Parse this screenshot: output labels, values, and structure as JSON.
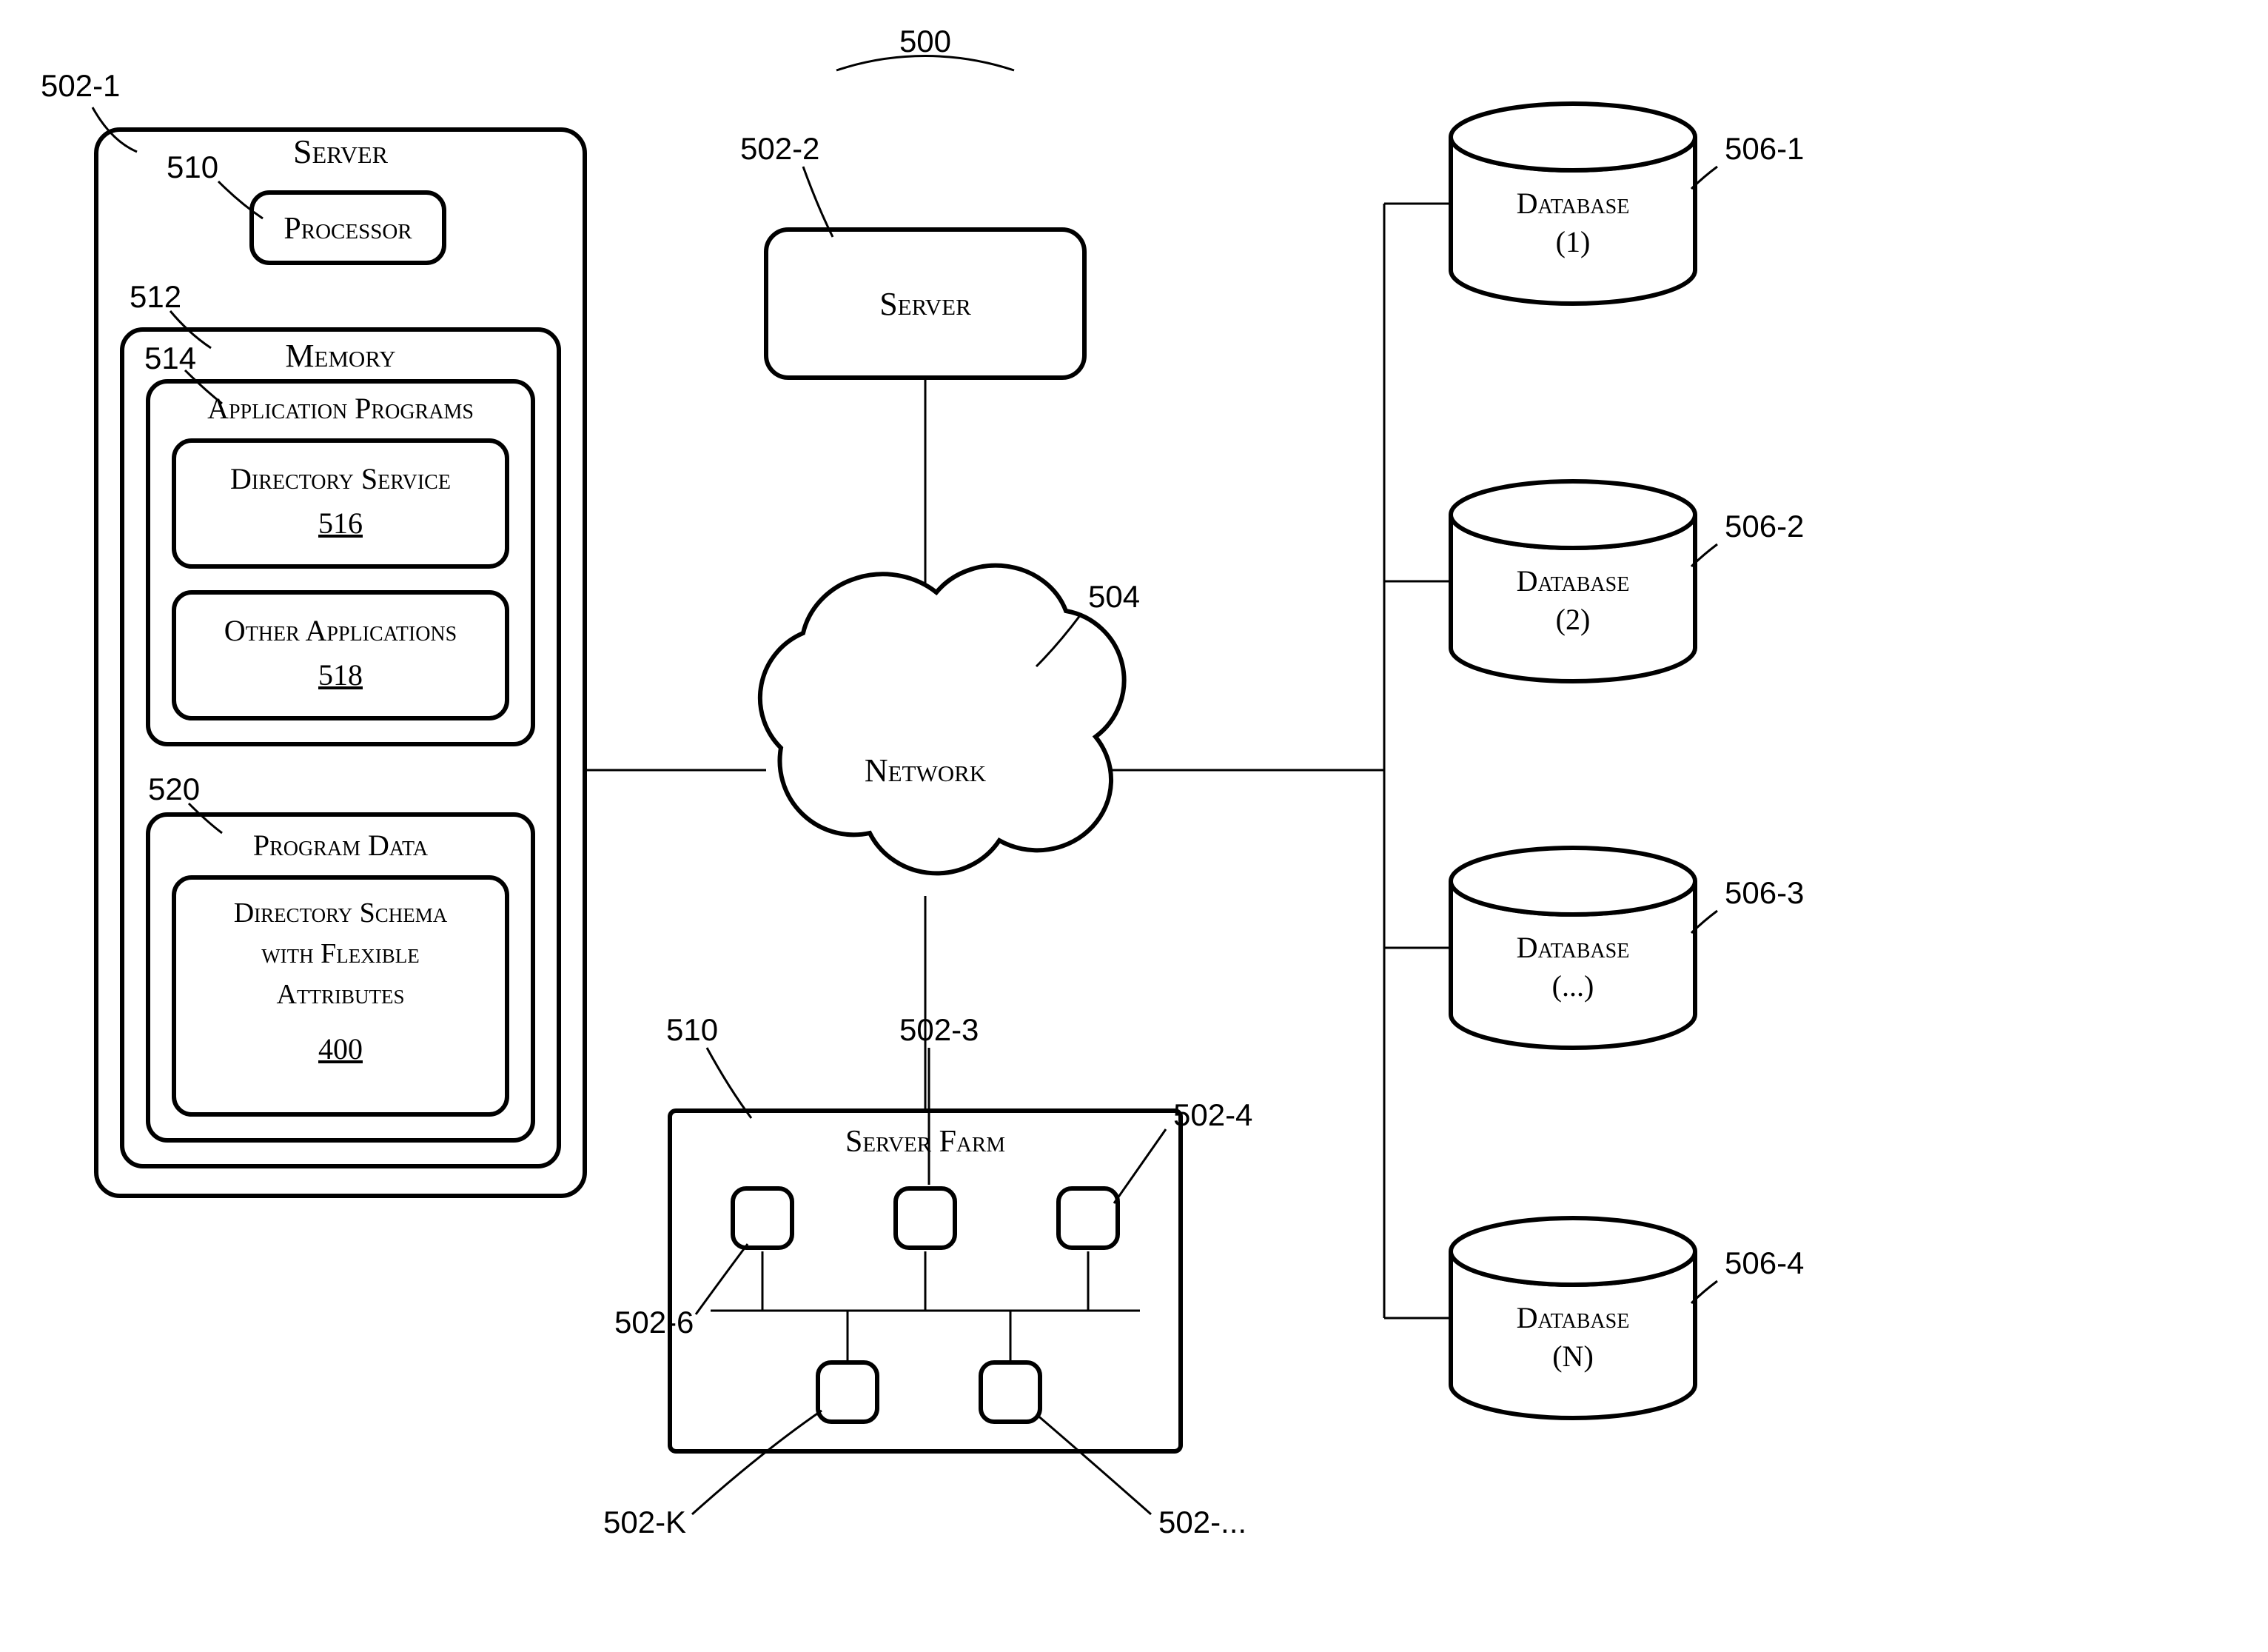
{
  "refs": {
    "figure": "500",
    "server1": "502-1",
    "server2": "502-2",
    "server_farm_3": "502-3",
    "server_farm_4": "502-4",
    "server_farm_6": "502-6",
    "server_farm_k": "502-K",
    "server_farm_dots": "502-...",
    "network": "504",
    "db1": "506-1",
    "db2": "506-2",
    "db3": "506-3",
    "db4": "506-4",
    "processor": "510",
    "server_farm_lead": "510",
    "memory": "512",
    "app_programs": "514",
    "dir_service": "516",
    "other_apps": "518",
    "program_data": "520",
    "dir_schema": "400"
  },
  "labels": {
    "server": "Server",
    "processor": "Processor",
    "memory": "Memory",
    "app_programs": "Application Programs",
    "dir_service": "Directory Service",
    "other_apps": "Other Applications",
    "program_data": "Program Data",
    "dir_schema_l1": "Directory Schema",
    "dir_schema_l2": "with Flexible",
    "dir_schema_l3": "Attributes",
    "network": "Network",
    "server_farm": "Server Farm",
    "database": "Database",
    "db_1": "(1)",
    "db_2": "(2)",
    "db_3": "(...)",
    "db_4": "(N)"
  }
}
